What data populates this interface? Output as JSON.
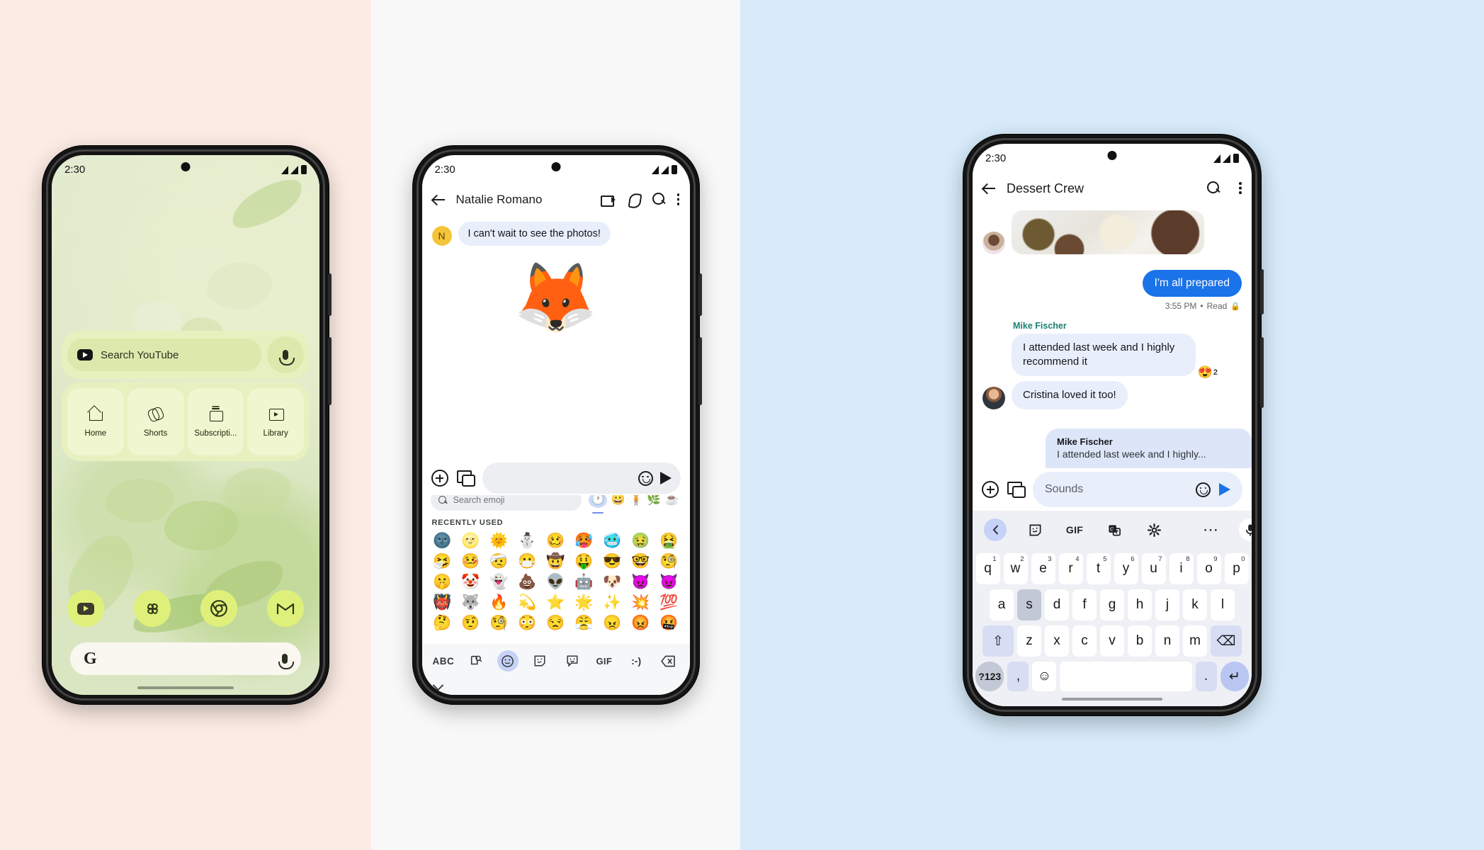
{
  "panels": {
    "left_bg": "#fcebe4",
    "middle_bg": "#f8f8f8",
    "right_bg": "#d7ebfa"
  },
  "phone1": {
    "status_time": "2:30",
    "widget": {
      "search_placeholder": "Search YouTube",
      "tabs": [
        {
          "label": "Home",
          "icon": "home-icon"
        },
        {
          "label": "Shorts",
          "icon": "shorts-icon"
        },
        {
          "label": "Subscripti...",
          "icon": "subscriptions-icon"
        },
        {
          "label": "Library",
          "icon": "library-icon"
        }
      ]
    },
    "dock": [
      {
        "name": "youtube",
        "icon": "youtube-icon"
      },
      {
        "name": "photos",
        "icon": "google-photos-icon"
      },
      {
        "name": "chrome",
        "icon": "chrome-icon"
      },
      {
        "name": "gmail",
        "icon": "gmail-icon"
      }
    ],
    "google_search": {
      "logo": "G",
      "mic": "mic-icon"
    }
  },
  "phone2": {
    "status_time": "2:30",
    "title": "Natalie Romano",
    "toolbar": [
      "video-call-icon",
      "phone-call-icon",
      "search-icon",
      "more-options-icon"
    ],
    "messages": [
      {
        "avatar_initial": "N",
        "text": "I can't wait to see the photos!"
      }
    ],
    "sent_sticker": "🦊",
    "composer": {
      "placeholder": "",
      "add": "plus-icon",
      "gallery": "gallery-icon",
      "emoji": "emoji-icon",
      "send": "send-icon"
    },
    "sticker_suggestions": [
      "🦊",
      "🐺",
      "🦊",
      "🦊"
    ],
    "emoji_search_placeholder": "Search emoji",
    "category_tabs": [
      "🕐",
      "😀",
      "🧍",
      "🌿",
      "☕"
    ],
    "recently_used_label": "RECENTLY USED",
    "recently_used": [
      "🌚",
      "🌝",
      "🌞",
      "⛄",
      "🥴",
      "🥵",
      "🥶",
      "🤢",
      "🤮",
      "🤧",
      "🤒",
      "🤕",
      "😷",
      "🤠",
      "🤑",
      "😎",
      "🤓",
      "🧐",
      "🤫",
      "🤡",
      "👻",
      "💩",
      "👽",
      "🤖",
      "🐶",
      "👿",
      "😈",
      "👹",
      "🐺",
      "🔥",
      "💫",
      "⭐",
      "🌟",
      "✨",
      "💥",
      "💯",
      "🤔",
      "🤨",
      "🧐",
      "😳",
      "😒",
      "😤",
      "😠",
      "😡",
      "🤬"
    ],
    "keyboard_bottom": [
      {
        "label": "ABC",
        "name": "abc-key"
      },
      {
        "label": "🔎",
        "name": "emoji-search-key"
      },
      {
        "label": "☺",
        "name": "emoji-tab-key",
        "active": true
      },
      {
        "label": "🖼",
        "name": "sticker-tab-key"
      },
      {
        "label": "💬",
        "name": "emoji-kitchen-key"
      },
      {
        "label": "GIF",
        "name": "gif-key"
      },
      {
        "label": ":-)",
        "name": "emoticon-key"
      },
      {
        "label": "⌫",
        "name": "backspace-key"
      }
    ]
  },
  "phone3": {
    "status_time": "2:30",
    "title": "Dessert Crew",
    "toolbar": [
      "search-icon",
      "more-options-icon"
    ],
    "sent_message": {
      "text": "I'm all prepared",
      "meta_time": "3:55 PM",
      "meta_status": "Read",
      "lock": "🔒"
    },
    "sender_name": "Mike Fischer",
    "received": [
      {
        "text": "I attended last week and I highly recommend it"
      },
      {
        "text": "Cristina loved it too!"
      }
    ],
    "reaction": {
      "emoji": "😍",
      "count": "2"
    },
    "reply_preview": {
      "name": "Mike Fischer",
      "text": "I attended last week and I highly..."
    },
    "composer": {
      "placeholder": "Sounds",
      "add": "plus-icon",
      "gallery": "gallery-icon",
      "emoji": "emoji-icon",
      "send": "send-icon"
    },
    "keyboard_toolbar": [
      {
        "label": "‹",
        "name": "back-toolbar-key",
        "active": true
      },
      {
        "label": "🖼",
        "name": "sticker-key"
      },
      {
        "label": "GIF",
        "name": "gif-key"
      },
      {
        "label": "⛭",
        "name": "translate-key"
      },
      {
        "label": "⚙",
        "name": "settings-key"
      },
      {
        "label": "⋯",
        "name": "more-key"
      },
      {
        "label": "🎤",
        "name": "mic-key"
      }
    ],
    "keyboard": {
      "row1": [
        {
          "k": "q",
          "n": "1"
        },
        {
          "k": "w",
          "n": "2"
        },
        {
          "k": "e",
          "n": "3"
        },
        {
          "k": "r",
          "n": "4"
        },
        {
          "k": "t",
          "n": "5"
        },
        {
          "k": "y",
          "n": "6"
        },
        {
          "k": "u",
          "n": "7"
        },
        {
          "k": "i",
          "n": "8"
        },
        {
          "k": "o",
          "n": "9"
        },
        {
          "k": "p",
          "n": "0"
        }
      ],
      "row2": [
        "a",
        "s",
        "d",
        "f",
        "g",
        "h",
        "j",
        "k",
        "l"
      ],
      "row2_highlight": "s",
      "row3": [
        "⇧",
        "z",
        "x",
        "c",
        "v",
        "b",
        "n",
        "m",
        "⌫"
      ],
      "row4": [
        "?123",
        ",",
        "☺",
        "",
        ".",
        "↵"
      ]
    }
  }
}
